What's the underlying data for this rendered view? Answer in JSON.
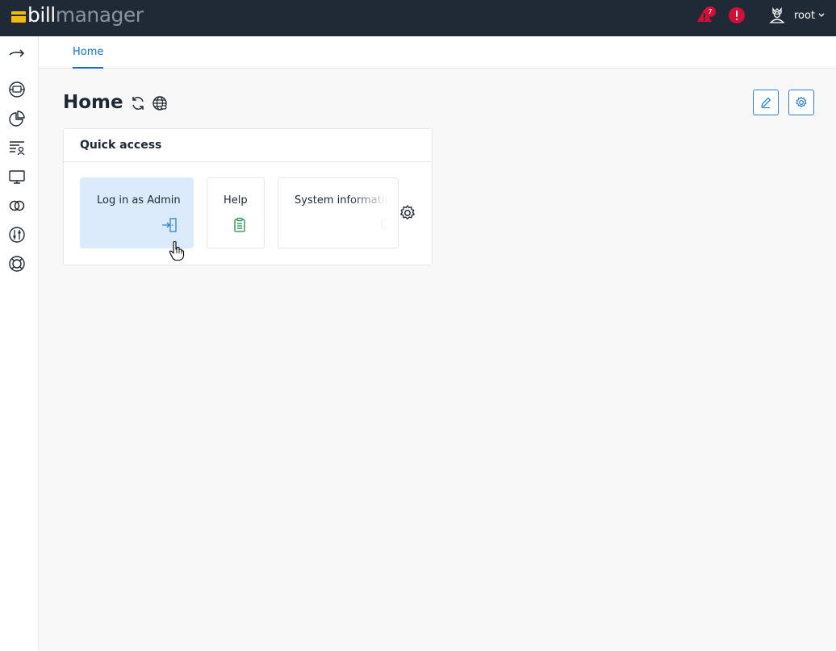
{
  "header": {
    "logo_part1": "bill",
    "logo_part2": "manager",
    "alert_count": "7",
    "user_name": "root"
  },
  "tabs": [
    {
      "label": "Home"
    }
  ],
  "page": {
    "title": "Home"
  },
  "quick_access": {
    "title": "Quick access",
    "tiles": [
      {
        "label": "Log in as Admin",
        "icon": "login-icon"
      },
      {
        "label": "Help",
        "icon": "document-icon"
      },
      {
        "label": "System information",
        "icon": "info-icon"
      }
    ]
  },
  "colors": {
    "header_bg": "#1f2a36",
    "accent": "#0e6fcb",
    "alert": "#d0103a",
    "logo_yellow": "#f2b90f",
    "tile_active": "#dcebfb"
  }
}
